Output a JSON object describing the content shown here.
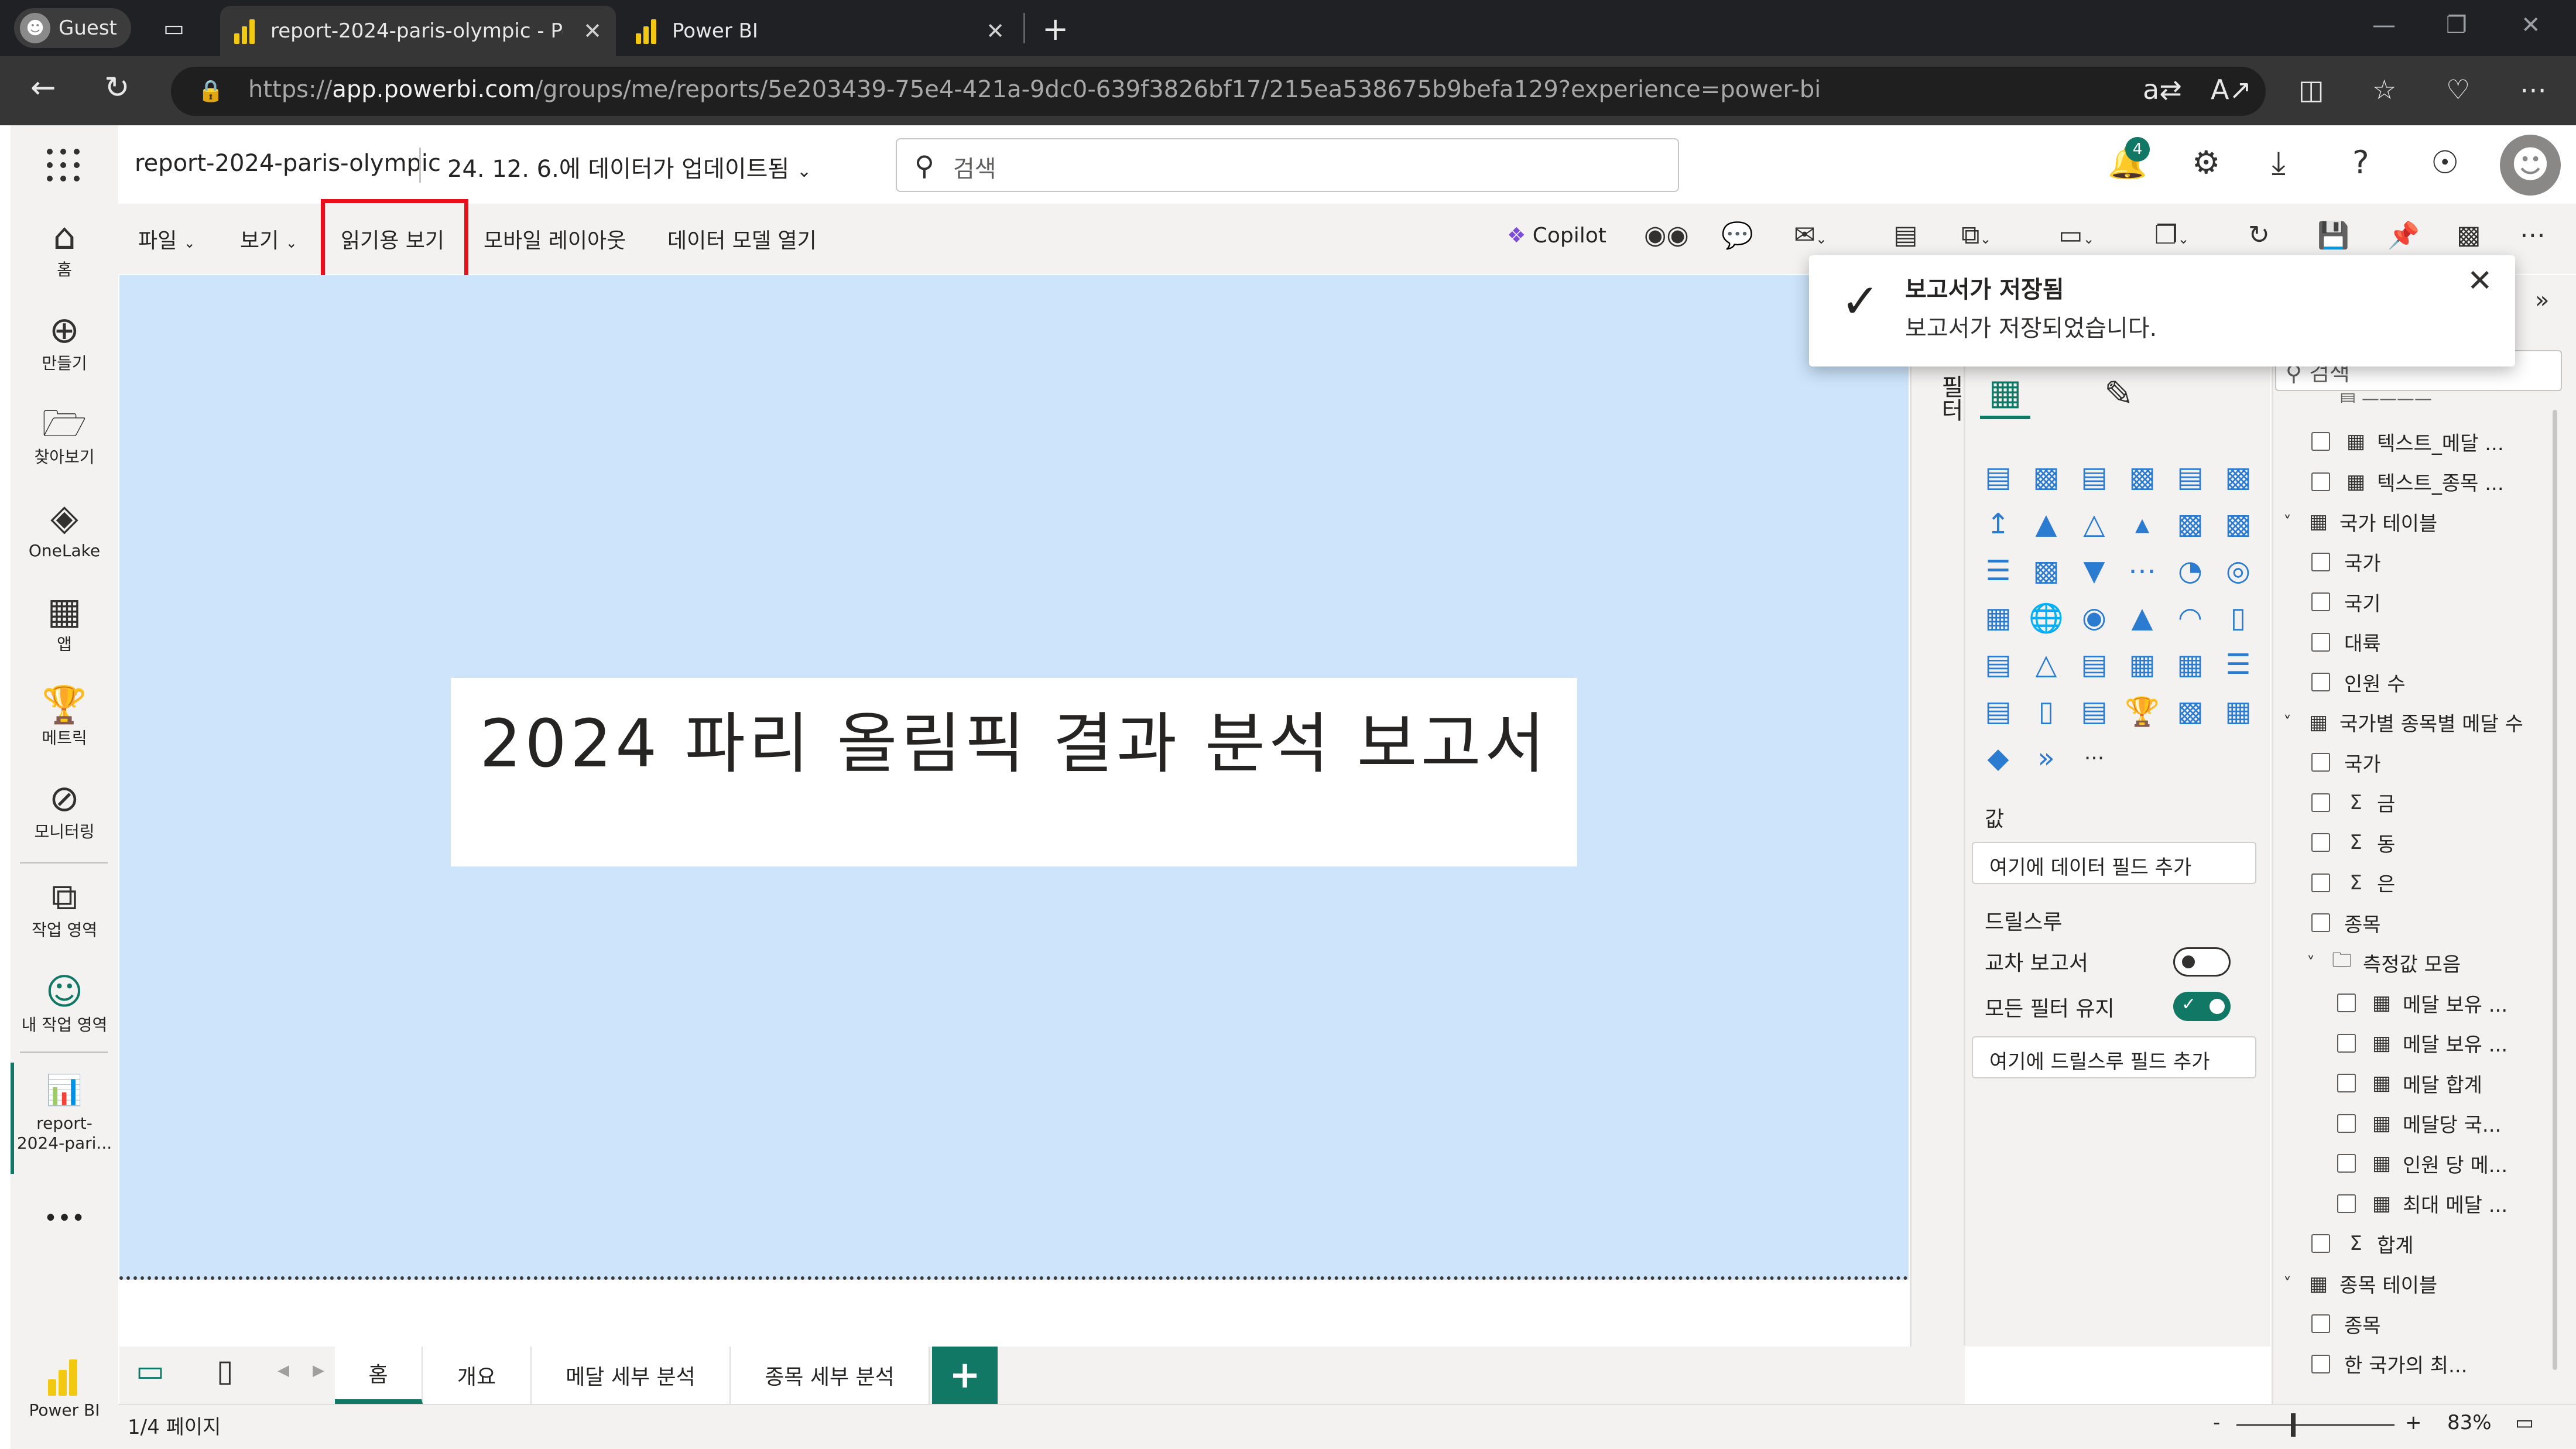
{
  "browser": {
    "guest_label": "Guest",
    "tabs": [
      {
        "title": "report-2024-paris-olympic - Pow"
      },
      {
        "title": "Power BI"
      }
    ],
    "new_tab": "+",
    "url_domain": "app.powerbi.com",
    "url_prefix": "https://",
    "url_path": "/groups/me/reports/5e203439-75e4-421a-9dc0-639f3826bf17/215ea538675b9befa129?experience=power-bi",
    "icons": [
      "back-icon",
      "refresh-icon",
      "lock-icon",
      "translate-icon",
      "read-aloud-icon",
      "split-screen-icon",
      "favorites-icon",
      "browser-essentials-icon",
      "more-icon"
    ]
  },
  "header": {
    "report_name": "report-2024-paris-olympic",
    "updated": "24. 12. 6.에 데이터가 업데이트됨",
    "search_placeholder": "검색",
    "notification_count": "4"
  },
  "nav": [
    {
      "label": "홈",
      "icon": "home-icon"
    },
    {
      "label": "만들기",
      "icon": "create-icon"
    },
    {
      "label": "찾아보기",
      "icon": "browse-icon"
    },
    {
      "label": "OneLake",
      "icon": "onelake-icon"
    },
    {
      "label": "앱",
      "icon": "apps-icon"
    },
    {
      "label": "메트릭",
      "icon": "metrics-icon"
    },
    {
      "label": "모니터링",
      "icon": "monitor-icon"
    },
    {
      "label": "작업 영역",
      "icon": "workspaces-icon"
    },
    {
      "label": "내 작업 영역",
      "icon": "my-workspace-icon"
    },
    {
      "label": "report-\n2024-pari...",
      "icon": "report-icon"
    },
    {
      "label": "•••",
      "icon": "more-icon"
    },
    {
      "label": "Power BI",
      "icon": "powerbi-logo-icon"
    }
  ],
  "ribbon": {
    "file": "파일",
    "view": "보기",
    "reading_view": "읽기용 보기",
    "mobile_layout": "모바일 레이아웃",
    "open_data_model": "데이터 모델 열기",
    "copilot": "Copilot"
  },
  "annotation": {
    "marker": "1"
  },
  "report": {
    "title": "2024 파리 올림픽 결과 분석 보고서"
  },
  "page_tabs": [
    "홈",
    "개요",
    "메달 세부 분석",
    "종목 세부 분석"
  ],
  "add_page": "+",
  "status": {
    "page_info": "1/4 페이지",
    "zoom": "83%",
    "zoom_level": 0.36
  },
  "viz": {
    "filters_label": "필터",
    "values_label": "값",
    "values_well": "여기에 데이터 필드 추가",
    "drillthrough_label": "드릴스루",
    "cross_report": "교차 보고서",
    "keep_filters": "모든 필터 유지",
    "cross_report_on": false,
    "keep_filters_on": true,
    "drill_well": "여기에 드릴스루 필드 추가",
    "more": "···"
  },
  "toast": {
    "title": "보고서가 저장됨",
    "message": "보고서가 저장되었습니다."
  },
  "data_pane": {
    "search_placeholder": "검색",
    "rows": [
      {
        "label": "텍스트_메달 ...",
        "kind": "measure"
      },
      {
        "label": "텍스트_종목 ...",
        "kind": "measure"
      },
      {
        "label": "국가 테이블",
        "kind": "table"
      },
      {
        "label": "국가",
        "kind": "field"
      },
      {
        "label": "국기",
        "kind": "field"
      },
      {
        "label": "대륙",
        "kind": "field"
      },
      {
        "label": "인원 수",
        "kind": "field"
      },
      {
        "label": "국가별 종목별 메달 수",
        "kind": "table"
      },
      {
        "label": "국가",
        "kind": "field"
      },
      {
        "label": "금",
        "kind": "sum"
      },
      {
        "label": "동",
        "kind": "sum"
      },
      {
        "label": "은",
        "kind": "sum"
      },
      {
        "label": "종목",
        "kind": "field"
      },
      {
        "label": "측정값 모음",
        "kind": "folder"
      },
      {
        "label": "메달 보유 ...",
        "kind": "measure"
      },
      {
        "label": "메달 보유 ...",
        "kind": "measure"
      },
      {
        "label": "메달 합계",
        "kind": "measure"
      },
      {
        "label": "메달당 국...",
        "kind": "measure"
      },
      {
        "label": "인원 당 메...",
        "kind": "measure"
      },
      {
        "label": "최대 메달 ...",
        "kind": "measure"
      },
      {
        "label": "합계",
        "kind": "sum"
      },
      {
        "label": "종목 테이블",
        "kind": "table"
      },
      {
        "label": "종목",
        "kind": "field"
      },
      {
        "label": "한 국가의 최...",
        "kind": "field"
      }
    ]
  },
  "colors": {
    "accent": "#117865",
    "canvas": "#cde4fb",
    "highlight": "#e8101b"
  }
}
